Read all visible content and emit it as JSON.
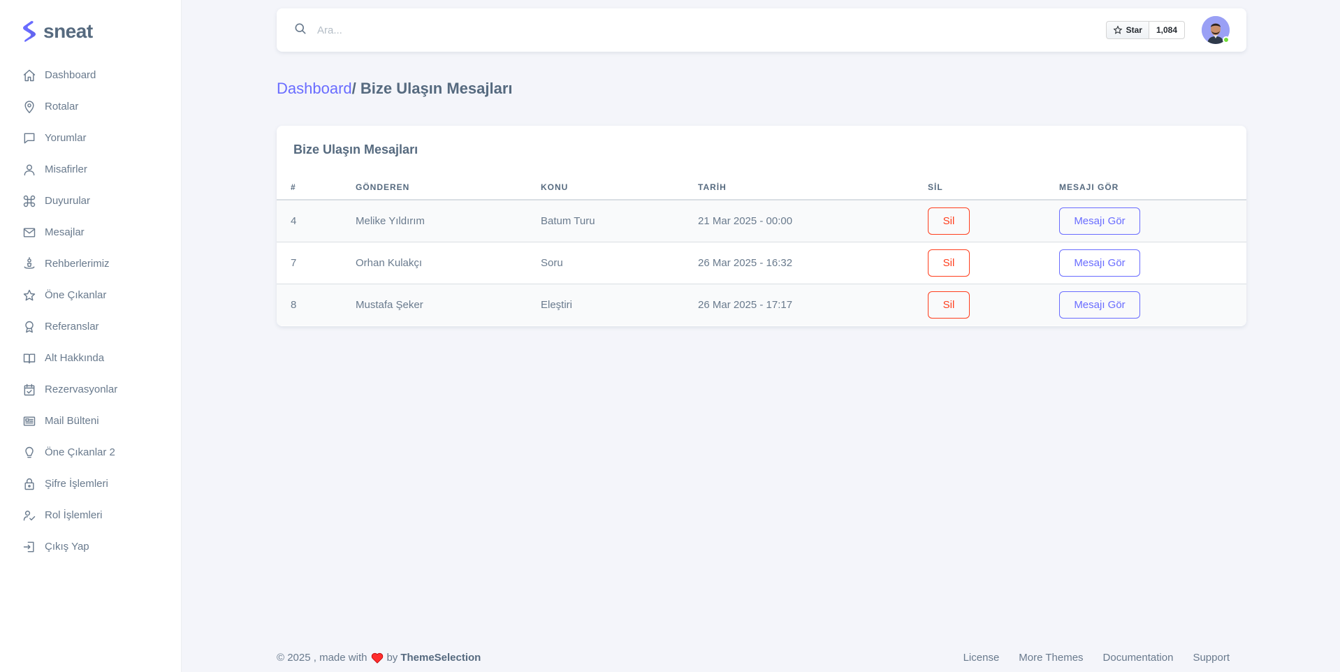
{
  "brand": {
    "name": "sneat"
  },
  "sidebar": {
    "items": [
      {
        "label": "Dashboard",
        "icon": "home-icon"
      },
      {
        "label": "Rotalar",
        "icon": "map-pin-icon"
      },
      {
        "label": "Yorumlar",
        "icon": "chat-icon"
      },
      {
        "label": "Misafirler",
        "icon": "user-icon"
      },
      {
        "label": "Duyurular",
        "icon": "command-icon"
      },
      {
        "label": "Mesajlar",
        "icon": "envelope-icon"
      },
      {
        "label": "Rehberlerimiz",
        "icon": "guide-icon"
      },
      {
        "label": "Öne Çıkanlar",
        "icon": "star-icon"
      },
      {
        "label": "Referanslar",
        "icon": "award-icon"
      },
      {
        "label": "Alt Hakkında",
        "icon": "book-icon"
      },
      {
        "label": "Rezervasyonlar",
        "icon": "calendar-check-icon"
      },
      {
        "label": "Mail Bülteni",
        "icon": "news-icon"
      },
      {
        "label": "Öne Çıkanlar 2",
        "icon": "bulb-icon"
      },
      {
        "label": "Şifre İşlemleri",
        "icon": "lock-icon"
      },
      {
        "label": "Rol İşlemleri",
        "icon": "user-check-icon"
      },
      {
        "label": "Çıkış Yap",
        "icon": "log-in-icon"
      }
    ]
  },
  "navbar": {
    "search_placeholder": "Ara...",
    "github": {
      "star_label": "Star",
      "count": "1,084"
    }
  },
  "page": {
    "breadcrumb_link": "Dashboard",
    "breadcrumb_current": "/ Bize Ulaşın Mesajları"
  },
  "card": {
    "title": "Bize Ulaşın Mesajları",
    "columns": [
      "#",
      "GÖNDEREN",
      "KONU",
      "TARİH",
      "SİL",
      "MESAJI GÖR"
    ],
    "rows": [
      {
        "id": "4",
        "sender": "Melike Yıldırım",
        "subject": "Batum Turu",
        "date": "21 Mar 2025 - 00:00",
        "delete_label": "Sil",
        "view_label": "Mesajı Gör"
      },
      {
        "id": "7",
        "sender": "Orhan Kulakçı",
        "subject": "Soru",
        "date": "26 Mar 2025 - 16:32",
        "delete_label": "Sil",
        "view_label": "Mesajı Gör"
      },
      {
        "id": "8",
        "sender": "Mustafa Şeker",
        "subject": "Eleştiri",
        "date": "26 Mar 2025 - 17:17",
        "delete_label": "Sil",
        "view_label": "Mesajı Gör"
      }
    ]
  },
  "footer": {
    "copyright": "© 2025 , made with",
    "by": "by",
    "company": "ThemeSelection",
    "links": [
      "License",
      "More Themes",
      "Documentation",
      "Support"
    ]
  },
  "colors": {
    "primary": "#696cff",
    "danger": "#ff3e1d",
    "text": "#566a7f",
    "background": "#f4f5fa",
    "online": "#71dd37"
  }
}
